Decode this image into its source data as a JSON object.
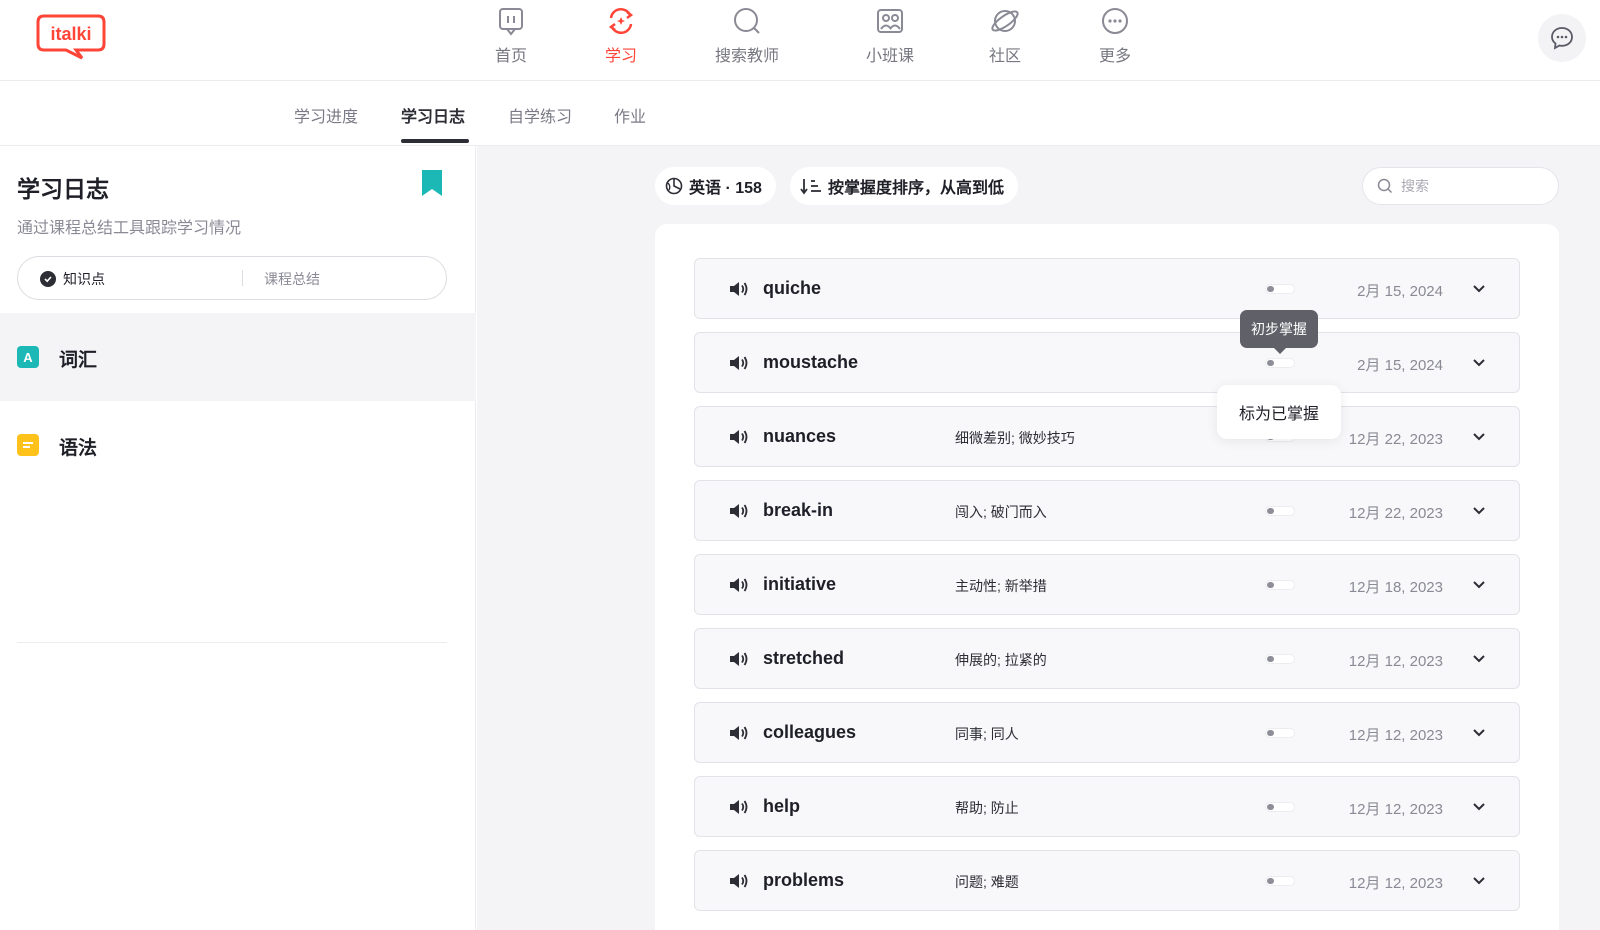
{
  "brand": {
    "logo_text": "italki",
    "color": "#ff4438"
  },
  "nav": {
    "items": [
      {
        "label": "首页",
        "icon": "home-icon"
      },
      {
        "label": "学习",
        "icon": "learn-icon",
        "active": true
      },
      {
        "label": "搜索教师",
        "icon": "search-teacher-icon"
      },
      {
        "label": "小班课",
        "icon": "group-class-icon"
      },
      {
        "label": "社区",
        "icon": "community-icon"
      },
      {
        "label": "更多",
        "icon": "more-icon"
      }
    ]
  },
  "subtabs": [
    {
      "label": "学习进度"
    },
    {
      "label": "学习日志",
      "active": true
    },
    {
      "label": "自学练习"
    },
    {
      "label": "作业"
    }
  ],
  "sidebar": {
    "title": "学习日志",
    "subtitle": "通过课程总结工具跟踪学习情况",
    "segment": {
      "option1": "知识点",
      "option2": "课程总结"
    },
    "items": [
      {
        "badge": "A",
        "label": "词汇",
        "badge_color": "#1cb8b5"
      },
      {
        "badge": "",
        "label": "语法",
        "badge_color": "#ffc21a"
      }
    ]
  },
  "toolbar": {
    "language_pill": "英语 · 158",
    "sort_pill": "按掌握度排序，从高到低",
    "search_placeholder": "搜索"
  },
  "vocab": [
    {
      "word": "quiche",
      "definition": "",
      "date": "2月 15, 2024"
    },
    {
      "word": "moustache",
      "definition": "",
      "date": "2月 15, 2024"
    },
    {
      "word": "nuances",
      "definition": "细微差别; 微妙技巧",
      "date": "12月 22, 2023"
    },
    {
      "word": "break-in",
      "definition": "闯入; 破门而入",
      "date": "12月 22, 2023"
    },
    {
      "word": "initiative",
      "definition": "主动性; 新举措",
      "date": "12月 18, 2023"
    },
    {
      "word": "stretched",
      "definition": "伸展的; 拉紧的",
      "date": "12月 12, 2023"
    },
    {
      "word": "colleagues",
      "definition": "同事; 同人",
      "date": "12月 12, 2023"
    },
    {
      "word": "help",
      "definition": "帮助; 防止",
      "date": "12月 12, 2023"
    },
    {
      "word": "problems",
      "definition": "问题; 难题",
      "date": "12月 12, 2023"
    }
  ],
  "tooltips": {
    "level": "初步掌握",
    "mark_mastered": "标为已掌握"
  }
}
